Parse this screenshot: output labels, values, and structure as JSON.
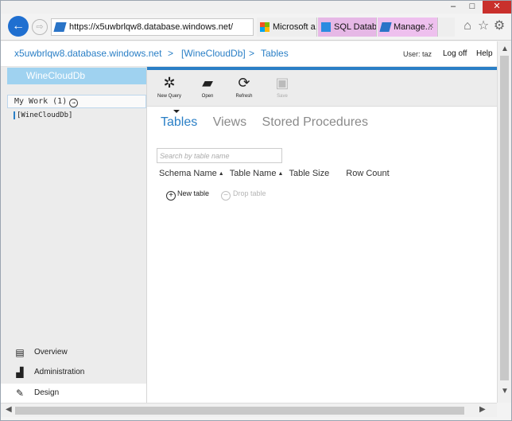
{
  "browser": {
    "window_controls": {
      "minimize": "–",
      "maximize": "□",
      "close": "✕"
    },
    "back_glyph": "←",
    "forward_glyph": "⇨",
    "address": "https://x5uwbrlqw8.database.windows.net/",
    "address_icons": "⌕ ▾ 🔒 ↻",
    "tabs": [
      {
        "label": "Microsoft a...",
        "icon": "microsoft-logo-icon"
      },
      {
        "label": "SQL Datab...",
        "icon": "sql-database-icon"
      },
      {
        "label": "Manage...",
        "icon": "azure-logo-icon",
        "close": "✕"
      }
    ],
    "tools": {
      "home": "⌂",
      "favorites": "☆",
      "settings": "⚙"
    }
  },
  "header": {
    "breadcrumb": [
      "x5uwbrlqw8.database.windows.net",
      "[WineCloudDb]",
      "Tables"
    ],
    "separator": ">",
    "user": "User: taz",
    "logoff": "Log off",
    "help": "Help"
  },
  "sidebar": {
    "database": "WineCloudDb",
    "my_work": "My Work (1)",
    "my_work_arrow": "→",
    "work_item": "[WineCloudDb]",
    "nav": [
      {
        "label": "Overview",
        "icon": "overview-icon"
      },
      {
        "label": "Administration",
        "icon": "administration-icon"
      },
      {
        "label": "Design",
        "icon": "design-icon"
      }
    ]
  },
  "ribbon": {
    "new_query": "New Query",
    "open": "Open",
    "refresh": "Refresh",
    "save": "Save"
  },
  "main": {
    "tabs": [
      "Tables",
      "Views",
      "Stored Procedures"
    ],
    "search_placeholder": "Search by table name",
    "columns": [
      "Schema Name",
      "Table Name",
      "Table Size",
      "Row Count"
    ],
    "sort_glyph": "▲",
    "new_table": "New table",
    "drop_table": "Drop table"
  },
  "scroll": {
    "up": "▲",
    "down": "▼",
    "left": "◀",
    "right": "▶"
  },
  "colors": {
    "accent": "#2a7fc6",
    "db_tile": "#9fd2f0",
    "tab_highlight": "#e6b8e6",
    "close_button": "#c9302c"
  }
}
